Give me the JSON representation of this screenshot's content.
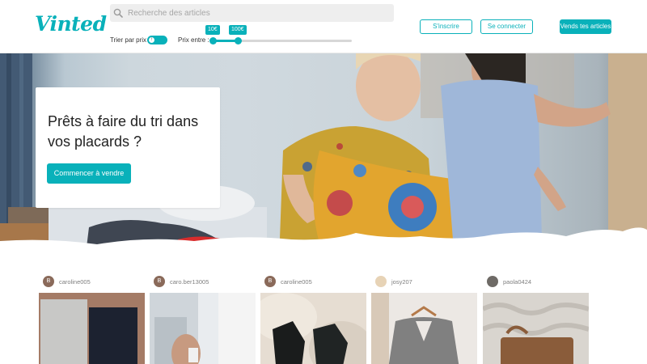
{
  "header": {
    "logo": "Vinted",
    "search": {
      "placeholder": "Recherche des articles",
      "value": ""
    },
    "sort": {
      "label": "Trier par prix :",
      "toggle_knob": "↑"
    },
    "price_range": {
      "label": "Prix entre :",
      "min_label": "10€",
      "max_label": "100€"
    },
    "actions": {
      "signup": "S'inscrire",
      "login": "Se connecter",
      "sell": "Vends tes articles"
    }
  },
  "hero": {
    "title": "Prêts à faire du tri dans vos placards ?",
    "cta": "Commencer à vendre"
  },
  "feed": {
    "items": [
      {
        "username": "caroline005",
        "avatar_letter": "B"
      },
      {
        "username": "caro.ber13005",
        "avatar_letter": "B"
      },
      {
        "username": "caroline005",
        "avatar_letter": "B"
      },
      {
        "username": "josy207",
        "avatar_letter": ""
      },
      {
        "username": "paola0424",
        "avatar_letter": ""
      }
    ]
  },
  "colors": {
    "accent": "#09b1ba",
    "avatar": "#8a6a5a"
  },
  "icons": [
    "search-icon"
  ]
}
